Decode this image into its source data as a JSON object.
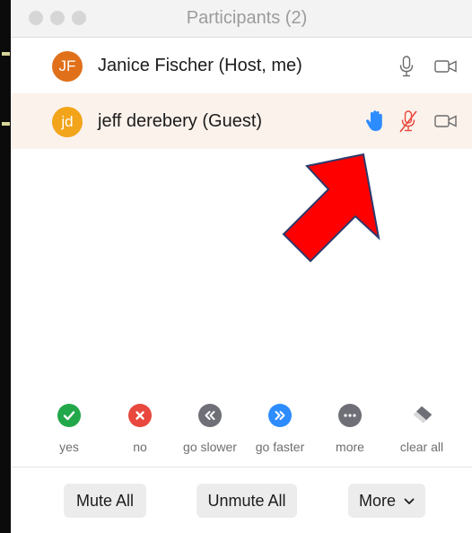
{
  "window": {
    "title": "Participants (2)"
  },
  "participants": [
    {
      "initials": "JF",
      "name": "Janice Fischer (Host, me)",
      "avatar_color": "#e0701a",
      "mic": "on",
      "video": "off"
    },
    {
      "initials": "jd",
      "name": "jeff derebery (Guest)",
      "avatar_color": "#f2a41a",
      "hand_raised": true,
      "mic": "muted",
      "video": "off"
    }
  ],
  "reactions": [
    {
      "label": "yes",
      "icon": "check-icon",
      "color": "#22a84a"
    },
    {
      "label": "no",
      "icon": "x-icon",
      "color": "#e8483d"
    },
    {
      "label": "go slower",
      "icon": "rewind-icon",
      "color": "#6f6f78"
    },
    {
      "label": "go faster",
      "icon": "fast-forward-icon",
      "color": "#2d8cff"
    },
    {
      "label": "more",
      "icon": "ellipsis-icon",
      "color": "#6f6f78"
    },
    {
      "label": "clear all",
      "icon": "eraser-icon",
      "color": "#8a8a8a"
    }
  ],
  "footer": {
    "mute_all": "Mute All",
    "unmute_all": "Unmute All",
    "more": "More"
  },
  "colors": {
    "highlight": "#fbf2ec",
    "raise_hand": "#2d8cff",
    "muted": "#e8483d",
    "annotation_arrow": "#ff0000"
  }
}
